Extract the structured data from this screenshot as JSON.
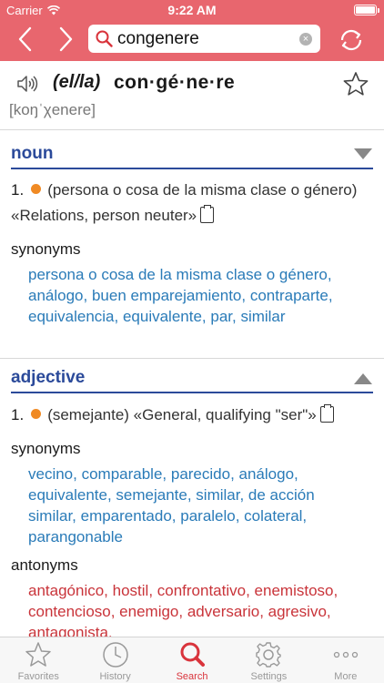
{
  "status": {
    "carrier": "Carrier",
    "time": "9:22 AM"
  },
  "search": {
    "value": "congenere",
    "clear_symbol": "×"
  },
  "entry": {
    "gender": "(el/la)",
    "headword": "con·gé·ne·re",
    "ipa": "[koŋˈχenere]"
  },
  "noun": {
    "label": "noun",
    "sense_number": "1.",
    "sense_text": "(persona o cosa de la misma clase o género) «Relations, person neuter»",
    "synonyms_label": "synonyms",
    "synonyms": "persona o cosa de la misma clase o género, análogo, buen emparejamiento, contraparte, equivalencia, equivalente, par, similar"
  },
  "adjective": {
    "label": "adjective",
    "sense_number": "1.",
    "sense_text": "(semejante) «General, qualifying \"ser\"»",
    "synonyms_label": "synonyms",
    "synonyms": "vecino, comparable, parecido, análogo, equivalente, semejante, similar, de acción similar, emparentado, paralelo, colateral, parangonable",
    "antonyms_label": "antonyms",
    "antonyms": "antagónico, hostil, confrontativo, enemistoso, contencioso, enemigo, adversario, agresivo, antagonista,"
  },
  "tabs": [
    {
      "label": "Favorites",
      "icon": "star-icon"
    },
    {
      "label": "History",
      "icon": "clock-icon"
    },
    {
      "label": "Search",
      "icon": "search-icon"
    },
    {
      "label": "Settings",
      "icon": "gear-icon"
    },
    {
      "label": "More",
      "icon": "more-icon"
    }
  ],
  "colors": {
    "accent": "#e8666e",
    "pos": "#2b4a9a",
    "synonym": "#2a7bb8",
    "antonym": "#c9343a",
    "active_tab": "#d9343c",
    "dot": "#f08a24"
  }
}
